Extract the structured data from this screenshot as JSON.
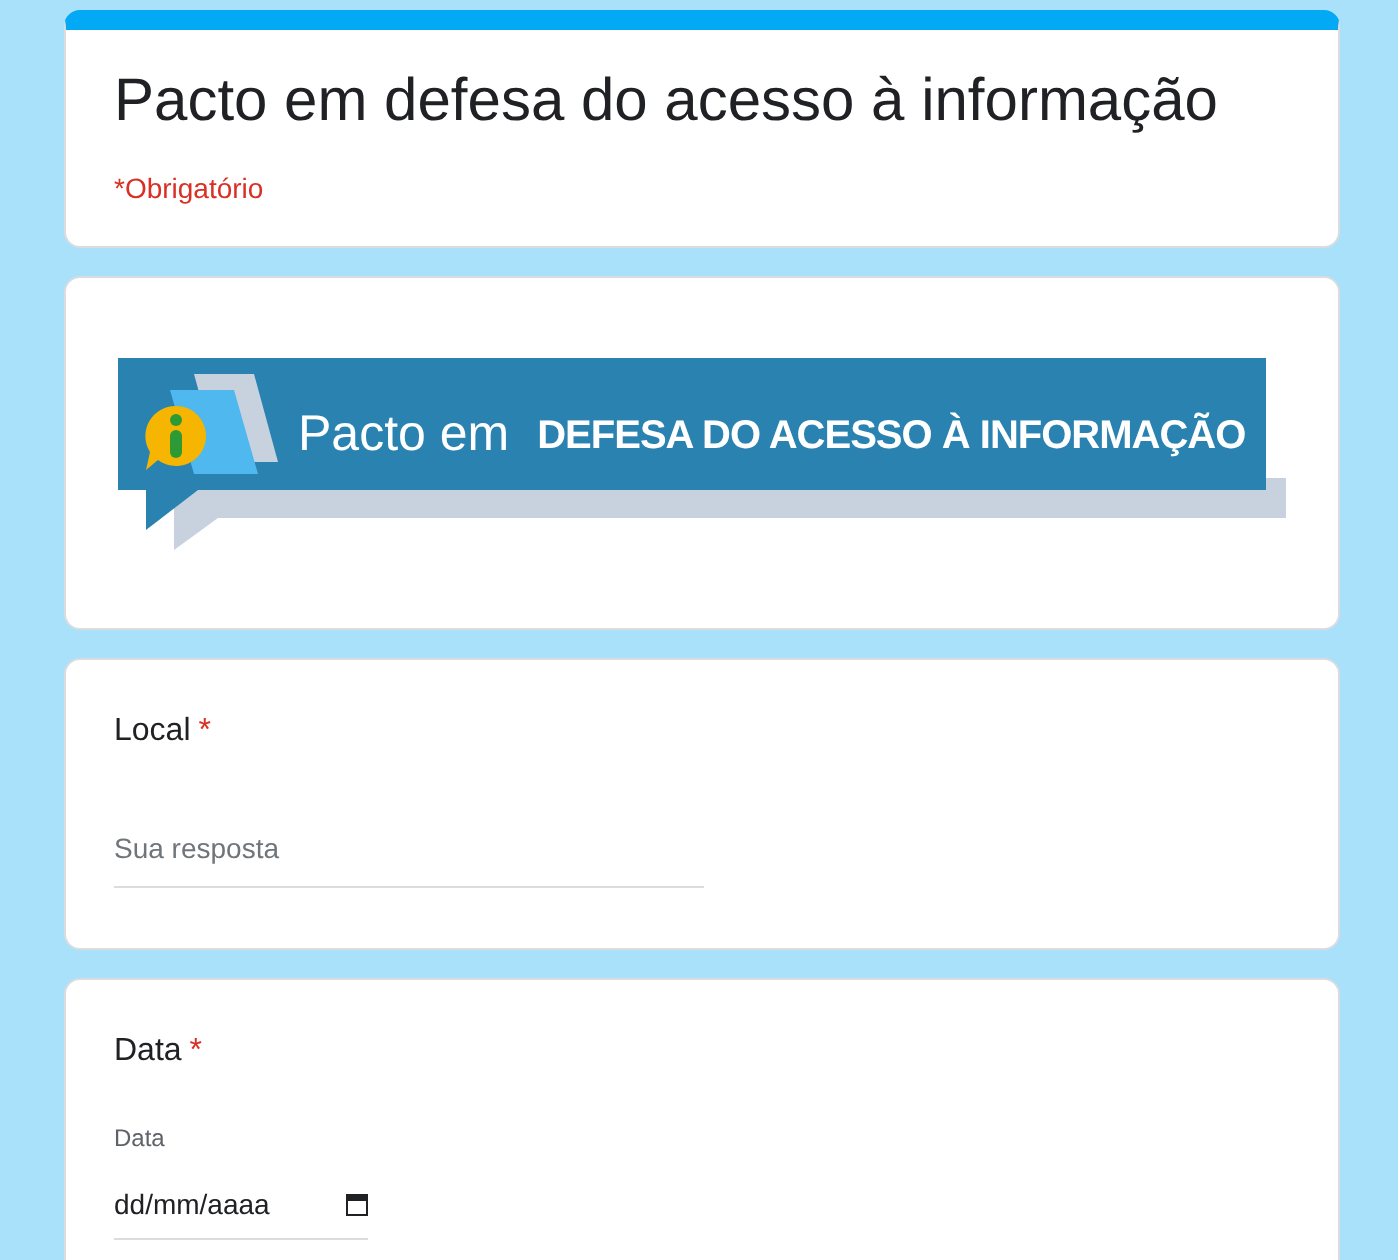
{
  "form": {
    "title": "Pacto em defesa do acesso à informação",
    "required_note": "*Obrigatório"
  },
  "banner": {
    "lead": "Pacto em",
    "headline": "DEFESA DO ACESSO À INFORMAÇÃO"
  },
  "questions": [
    {
      "kind": "text",
      "label": "Local",
      "required_mark": "*",
      "placeholder": "Sua resposta"
    },
    {
      "kind": "date",
      "label": "Data",
      "required_mark": "*",
      "sublabel": "Data",
      "value": "dd/mm/aaaa"
    }
  ]
}
